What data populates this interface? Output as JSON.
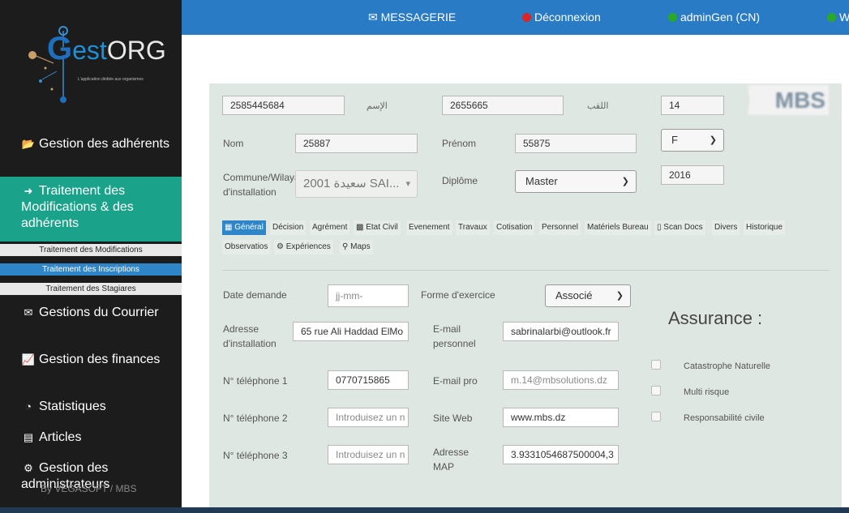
{
  "sidebar": {
    "logo_text": "GestORG",
    "logo_tagline": "L'application dédiée aux organismes",
    "items": [
      {
        "icon": "folder-open-icon",
        "label": "Gestion des adhérents"
      },
      {
        "icon": "sign-in-icon",
        "label": "Traitement des Modifications & des adhérents"
      },
      {
        "icon": "courier-icon",
        "label": "Gestions du Courrier"
      },
      {
        "icon": "line-chart-icon",
        "label": "Gestion des finances"
      },
      {
        "icon": "pie-chart-icon",
        "label": "Statistiques"
      },
      {
        "icon": "newspaper-icon",
        "label": "Articles"
      },
      {
        "icon": "users-gear-icon",
        "label": "Gestion des administrateurs"
      }
    ],
    "submenu": [
      "Traitement des Modifications",
      "Traitement des Inscriptions",
      "Traitement des Stagiares"
    ],
    "footer": "By VEGASOFT / MBS"
  },
  "topbar": {
    "messagerie": "MESSAGERIE",
    "logout": "Déconnexion",
    "user": "adminGen (CN)",
    "extra": "W",
    "colors": {
      "bar": "#2a7bc6",
      "logout_dot": "#d62828",
      "user_dot": "#2aa82a"
    }
  },
  "form": {
    "row1": {
      "ism_value": "2585445684",
      "ism_label": "الإسم",
      "laqab_value": "2655665",
      "laqab_label": "اللقب",
      "small_value": "14"
    },
    "row2": {
      "nom_label": "Nom",
      "nom_value": "25887",
      "prenom_label": "Prénom",
      "prenom_value": "55875",
      "sexe_value": "F"
    },
    "row3": {
      "commune_label": "Commune/Wilaya d'installation",
      "commune_value": "2001 سعيدة SAI...",
      "diplome_label": "Diplôme",
      "diplome_value": "Master",
      "year_value": "2016"
    },
    "logo_text": "MBS"
  },
  "tabs": [
    {
      "label": "Général",
      "active": true
    },
    {
      "label": "Décision"
    },
    {
      "label": "Agrément"
    },
    {
      "label": "Etat Civil"
    },
    {
      "label": "Evenement"
    },
    {
      "label": "Travaux"
    },
    {
      "label": "Cotisation"
    },
    {
      "label": "Personnel"
    },
    {
      "label": "Matériels Bureau"
    },
    {
      "label": "Scan Docs"
    },
    {
      "label": "Divers"
    },
    {
      "label": "Historique"
    },
    {
      "label": "Observatios"
    },
    {
      "label": "Expériences"
    },
    {
      "label": "Maps"
    }
  ],
  "general": {
    "date_label": "Date demande",
    "date_placeholder": "jj-mm-",
    "forme_label": "Forme d'exercice",
    "forme_value": "Associé",
    "adresse_label": "Adresse d'installation",
    "adresse_value": "65 rue Ali Haddad  ElMo",
    "email_perso_label": "E-mail personnel",
    "email_perso_value": "sabrinalarbi@outlook.fr",
    "tel1_label": "N° téléphone 1",
    "tel1_value": "0770715865",
    "email_pro_label": "E-mail pro",
    "email_pro_value": "m.14@mbsolutions.dz",
    "tel2_label": "N° téléphone 2",
    "tel2_placeholder": "Introduisez un n",
    "site_label": "Site Web",
    "site_value": "www.mbs.dz",
    "tel3_label": "N° téléphone 3",
    "tel3_placeholder": "Introduisez un n",
    "map_label": "Adresse MAP",
    "map_value": "3.9331054687500004,3"
  },
  "assurance": {
    "title": "Assurance :",
    "options": [
      "Catastrophe Naturelle",
      "Multi risque",
      "Responsabilité civile"
    ]
  }
}
